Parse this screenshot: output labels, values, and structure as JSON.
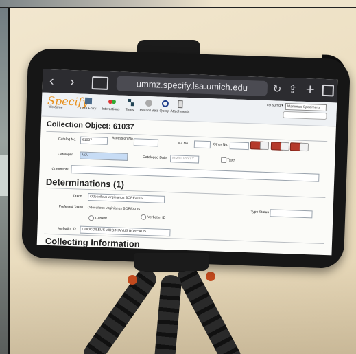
{
  "browser": {
    "url": "ummz.specify.lsa.umich.edu"
  },
  "app": {
    "logo": "Specify",
    "toolbar": [
      "Welcome",
      "Data Entry",
      "Interactions",
      "Trees",
      "Record Sets",
      "Query",
      "Attachments"
    ],
    "login": "csrlsumg ▾",
    "collection": "Mammals Specimens"
  },
  "form": {
    "title": "Collection Object: 61037",
    "catalog_no_label": "Catalog No.",
    "catalog_no_value": "61037",
    "accession_label": "Accession No.",
    "mz_label": "MZ No.",
    "other_label": "Other No.",
    "cataloger_label": "Cataloger",
    "cataloger_value": "N/A",
    "cataloged_date_label": "Cataloged Date",
    "cataloged_date_placeholder": "MM/DD/YYYY",
    "type_label": "Type",
    "comments_label": "Comments",
    "determinations_header": "Determinations (1)",
    "taxon_label": "Taxon",
    "taxon_value": "Odocoileus virginianus BOREALIS",
    "preferred_taxon_label": "Preferred Taxon",
    "preferred_taxon_value": "Odocoileus virginianus BOREALIS",
    "type_status_label": "Type Status",
    "current_label": "Current",
    "verbatim_id_checkbox_label": "Verbatim ID",
    "verbatim_id_label": "Verbatim ID",
    "verbatim_id_value": "ODOCOILEUS VIRGINIANUS BOREALIS",
    "collecting_header": "Collecting Information"
  },
  "colors": {
    "wall": "#efe4cc",
    "phone": "#161616",
    "safari_bar": "#2c2c30",
    "logo": "#e8911e",
    "button_red": "#b53a2b"
  }
}
